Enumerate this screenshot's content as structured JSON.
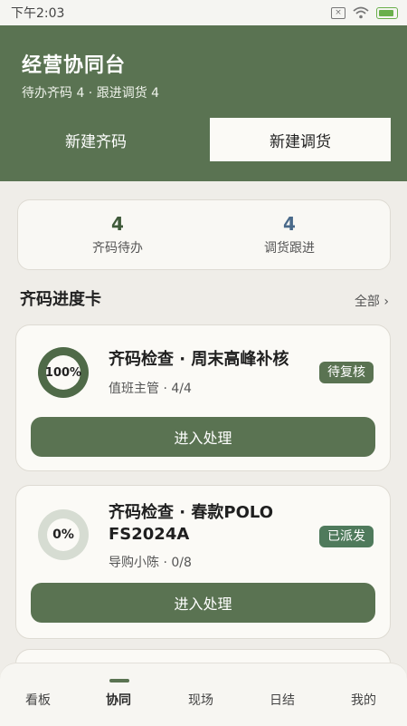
{
  "status_bar": {
    "time": "下午2:03",
    "icons": [
      "notification-x-icon",
      "wifi-icon",
      "battery-charging-icon"
    ]
  },
  "header": {
    "title": "经营协同台",
    "subtitle": "待办齐码 4 · 跟进调货 4",
    "btn_new_qima": "新建齐码",
    "btn_new_transfer": "新建调货"
  },
  "summary": {
    "qima_count": "4",
    "qima_label": "齐码待办",
    "transfer_count": "4",
    "transfer_label": "调货跟进"
  },
  "section": {
    "title": "齐码进度卡",
    "more": "全部 ›"
  },
  "tasks": [
    {
      "progress_text": "100%",
      "progress": 1.0,
      "title": "齐码检查 · 周末高峰补核",
      "meta": "值班主管 · 4/4",
      "badge": "待复核",
      "action": "进入处理"
    },
    {
      "progress_text": "0%",
      "progress": 0.0,
      "title": "齐码检查 · 春款POLO FS2024A",
      "meta": "导购小陈 · 0/8",
      "badge": "已派发",
      "action": "进入处理"
    }
  ],
  "nav": {
    "items": [
      "看板",
      "协同",
      "现场",
      "日结",
      "我的"
    ],
    "active": "协同"
  },
  "colors": {
    "primary": "#5a7352",
    "background": "#efede8",
    "accent_blue": "#4a6a8a"
  }
}
